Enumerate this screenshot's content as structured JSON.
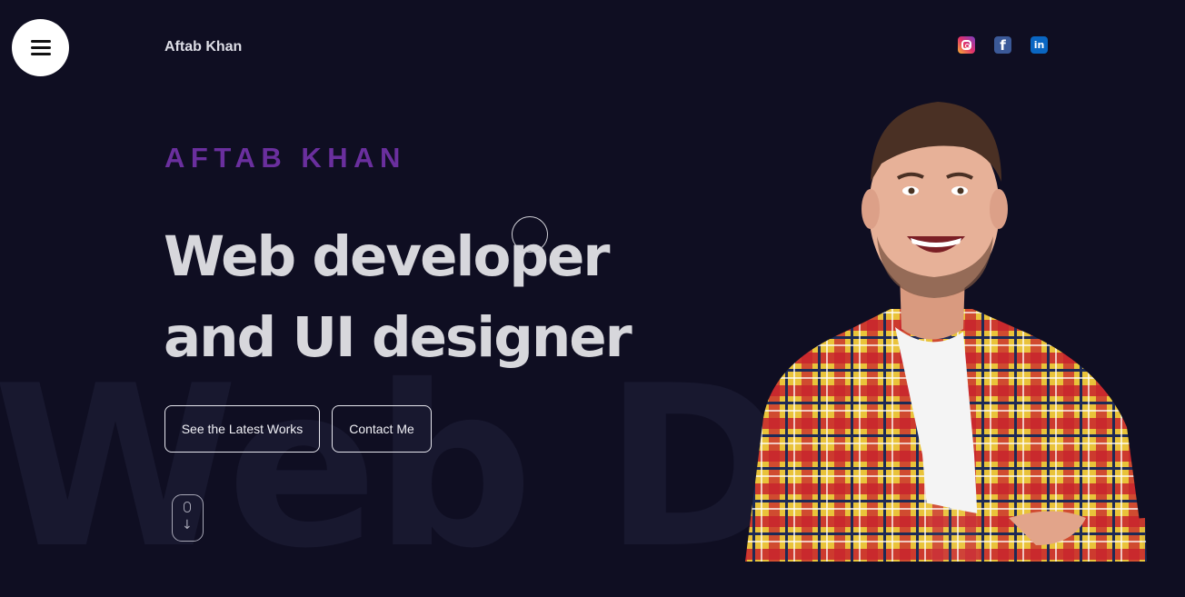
{
  "header": {
    "menu_icon": "hamburger-menu-icon",
    "brand": "Aftab Khan",
    "social": [
      {
        "name": "instagram-icon",
        "color": "#e1306c"
      },
      {
        "name": "facebook-icon",
        "color": "#3b5998"
      },
      {
        "name": "linkedin-icon",
        "color": "#0a66c2"
      }
    ]
  },
  "hero": {
    "eyebrow": "AFTAB KHAN",
    "headline_line1": "Web developer",
    "headline_line2": "and UI designer",
    "buttons": {
      "works": "See the Latest Works",
      "contact": "Contact Me"
    },
    "background_text": "Web De",
    "scroll_icon": "mouse-scroll-icon",
    "image": "portrait-photo"
  },
  "colors": {
    "background": "#0f0e22",
    "accent": "#6a2f9e",
    "headline": "#d7d7dc",
    "background_text": "#18182f"
  }
}
